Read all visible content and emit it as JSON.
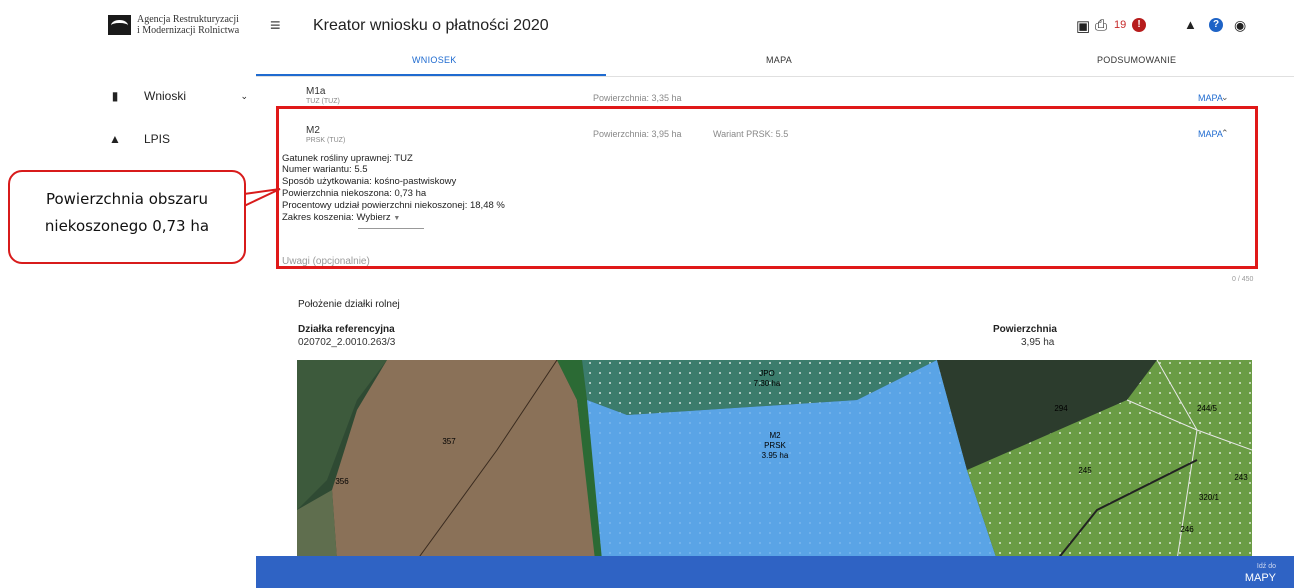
{
  "org": {
    "line1": "Agencja Restrukturyzacji",
    "line2": "i Modernizacji Rolnictwa"
  },
  "sidebar": {
    "items": [
      {
        "label": "Wnioski"
      },
      {
        "label": "LPIS"
      }
    ]
  },
  "header": {
    "title": "Kreator wniosku o płatności 2020",
    "error_count": "19"
  },
  "icons": {
    "menu": "menu-icon",
    "save": "save-icon",
    "print": "print-icon",
    "alert": "alert-icon",
    "bell": "bell-icon",
    "help": "help-icon",
    "account": "account-icon"
  },
  "tabs": [
    {
      "label": "WNIOSEK"
    },
    {
      "label": "MAPA"
    },
    {
      "label": "PODSUMOWANIE"
    }
  ],
  "parcels": [
    {
      "name": "M1a",
      "sub": "TUZ (TUZ)",
      "area": "Powierzchnia: 3,35 ha",
      "map": "MAPA"
    },
    {
      "name": "M2",
      "sub": "PRSK (TUZ)",
      "area": "Powierzchnia: 3,95 ha",
      "variant": "Wariant PRSK: 5.5",
      "map": "MAPA"
    }
  ],
  "details": {
    "species": "Gatunek rośliny uprawnej: TUZ",
    "variant_no": "Numer wariantu: 5.5",
    "usage": "Sposób użytkowania: kośno-pastwiskowy",
    "unmown_area": "Powierzchnia niekoszona: 0,73 ha",
    "unmown_pct": "Procentowy udział powierzchni niekoszonej: 18,48 %",
    "mowing_label": "Zakres koszenia:",
    "mowing_value": "Wybierz"
  },
  "notes": {
    "placeholder": "Uwagi (opcjonalnie)",
    "counter": "0 / 450"
  },
  "location": {
    "title": "Położenie działki rolnej",
    "ref_header": "Działka referencyjna",
    "ref_value": "020702_2.0010.263/3",
    "area_header": "Powierzchnia",
    "area_value": "3,95 ha"
  },
  "map_labels": {
    "jpo": "JPO",
    "jpo_area": "7.30 ha",
    "m2": "M2",
    "m2_type": "PRSK",
    "m2_area": "3.95 ha",
    "p357": "357",
    "p356": "356",
    "p294": "294",
    "p245": "245",
    "p2445": "244/5",
    "p243": "243",
    "p2441": "320/1",
    "p246": "246"
  },
  "footer": {
    "goto_small": "Idź do",
    "goto_big": "MAPY"
  },
  "callout": {
    "line1": "Powierzchnia obszaru",
    "line2": "niekoszonego 0,73 ha"
  },
  "colors": {
    "accent": "#1f6bd0",
    "frame": "#e01818",
    "bottom_bar": "#2f63c4"
  }
}
